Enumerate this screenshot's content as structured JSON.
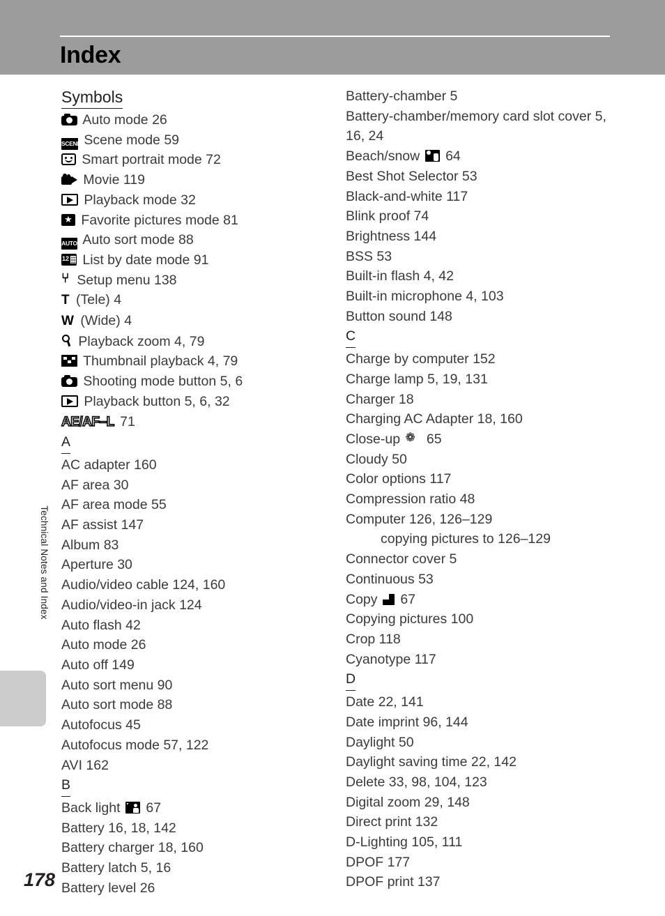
{
  "header": {
    "title": "Index"
  },
  "side": {
    "chapter_label": "Technical Notes and Index"
  },
  "page_number": "178",
  "columns": {
    "left": {
      "symbols_heading": "Symbols",
      "symbol_entries": [
        {
          "icon": "camera-icon",
          "text": "Auto mode 26"
        },
        {
          "icon": "scene-icon",
          "text": "Scene mode 59"
        },
        {
          "icon": "smart-portrait-icon",
          "text": "Smart portrait mode 72"
        },
        {
          "icon": "movie-icon",
          "text": "Movie 119"
        },
        {
          "icon": "playback-icon",
          "text": "Playback mode 32"
        },
        {
          "icon": "favorite-star-icon",
          "text": "Favorite pictures mode 81"
        },
        {
          "icon": "auto-sort-icon",
          "text": "Auto sort mode 88"
        },
        {
          "icon": "list-by-date-icon",
          "text": "List by date mode 91"
        },
        {
          "icon": "wrench-icon",
          "text": "Setup menu 138"
        },
        {
          "icon": "tele-letter-icon",
          "text": "(Tele) 4"
        },
        {
          "icon": "wide-letter-icon",
          "text": "(Wide) 4"
        },
        {
          "icon": "magnifier-icon",
          "text": "Playback zoom 4, 79"
        },
        {
          "icon": "thumbnail-icon",
          "text": "Thumbnail playback 4, 79"
        },
        {
          "icon": "camera-icon",
          "text": "Shooting mode button 5, 6"
        },
        {
          "icon": "playback-icon",
          "text": "Playback button 5, 6, 32"
        },
        {
          "icon": "ae-af-l-icon",
          "text": "71"
        }
      ],
      "section_a_letter": "A",
      "section_a_entries": [
        "AC adapter 160",
        "AF area 30",
        "AF area mode 55",
        "AF assist 147",
        "Album 83",
        "Aperture 30",
        "Audio/video cable 124, 160",
        "Audio/video-in jack 124",
        "Auto flash 42",
        "Auto mode 26",
        "Auto off 149",
        "Auto sort menu 90",
        "Auto sort mode 88",
        "Autofocus 45",
        "Autofocus mode 57, 122",
        "AVI 162"
      ],
      "section_b_letter": "B",
      "section_b_entries": [
        {
          "pre": "Back light",
          "icon": "backlight-icon",
          "post": "67"
        },
        {
          "pre": "Battery 16, 18, 142",
          "icon": null,
          "post": ""
        },
        {
          "pre": "Battery charger 18, 160",
          "icon": null,
          "post": ""
        },
        {
          "pre": "Battery latch 5, 16",
          "icon": null,
          "post": ""
        },
        {
          "pre": "Battery level 26",
          "icon": null,
          "post": ""
        }
      ]
    },
    "right": {
      "section_b_entries": [
        {
          "pre": "Battery-chamber 5",
          "icon": null,
          "post": ""
        },
        {
          "pre": "Battery-chamber/memory card slot cover 5, 16, 24",
          "icon": null,
          "post": "",
          "wrap": true
        },
        {
          "pre": "Beach/snow",
          "icon": "beach-snow-icon",
          "post": "64"
        },
        {
          "pre": "Best Shot Selector 53",
          "icon": null,
          "post": ""
        },
        {
          "pre": "Black-and-white 117",
          "icon": null,
          "post": ""
        },
        {
          "pre": "Blink proof 74",
          "icon": null,
          "post": ""
        },
        {
          "pre": "Brightness 144",
          "icon": null,
          "post": ""
        },
        {
          "pre": "BSS 53",
          "icon": null,
          "post": ""
        },
        {
          "pre": "Built-in flash 4, 42",
          "icon": null,
          "post": ""
        },
        {
          "pre": "Built-in microphone 4, 103",
          "icon": null,
          "post": ""
        },
        {
          "pre": "Button sound 148",
          "icon": null,
          "post": ""
        }
      ],
      "section_c_letter": "C",
      "section_c_entries": [
        {
          "pre": "Charge by computer 152",
          "icon": null,
          "post": ""
        },
        {
          "pre": "Charge lamp 5, 19, 131",
          "icon": null,
          "post": ""
        },
        {
          "pre": "Charger 18",
          "icon": null,
          "post": ""
        },
        {
          "pre": "Charging AC Adapter 18, 160",
          "icon": null,
          "post": ""
        },
        {
          "pre": "Close-up",
          "icon": "close-up-icon",
          "post": "65"
        },
        {
          "pre": "Cloudy 50",
          "icon": null,
          "post": ""
        },
        {
          "pre": "Color options 117",
          "icon": null,
          "post": ""
        },
        {
          "pre": "Compression ratio 48",
          "icon": null,
          "post": ""
        },
        {
          "pre": "Computer 126, 126–129",
          "icon": null,
          "post": ""
        },
        {
          "pre": "copying pictures to 126–129",
          "icon": null,
          "post": "",
          "sub": true
        },
        {
          "pre": "Connector cover 5",
          "icon": null,
          "post": ""
        },
        {
          "pre": "Continuous 53",
          "icon": null,
          "post": ""
        },
        {
          "pre": "Copy",
          "icon": "copy-icon",
          "post": "67"
        },
        {
          "pre": "Copying pictures 100",
          "icon": null,
          "post": ""
        },
        {
          "pre": "Crop 118",
          "icon": null,
          "post": ""
        },
        {
          "pre": "Cyanotype 117",
          "icon": null,
          "post": ""
        }
      ],
      "section_d_letter": "D",
      "section_d_entries": [
        "Date 22, 141",
        "Date imprint 96, 144",
        "Daylight 50",
        "Daylight saving time 22, 142",
        "Delete 33, 98, 104, 123",
        "Digital zoom 29, 148",
        "Direct print 132",
        "D-Lighting 105, 111",
        "DPOF 177",
        "DPOF print 137"
      ]
    }
  },
  "icon_labels": {
    "scene_text": "SCENE",
    "auto_text": "AUTO",
    "date_text": "12",
    "tele_letter": "T",
    "wide_letter": "W",
    "wrench_glyph": "⑂",
    "star_glyph": "★",
    "flower_glyph": "❁",
    "ae_af_l": "AE/AF–L"
  },
  "colors": {
    "header_band": "#9c9c9c",
    "side_tab": "#cccccc",
    "text": "#3a3a3a",
    "heading": "#231f20",
    "rule": "#ffffff"
  }
}
